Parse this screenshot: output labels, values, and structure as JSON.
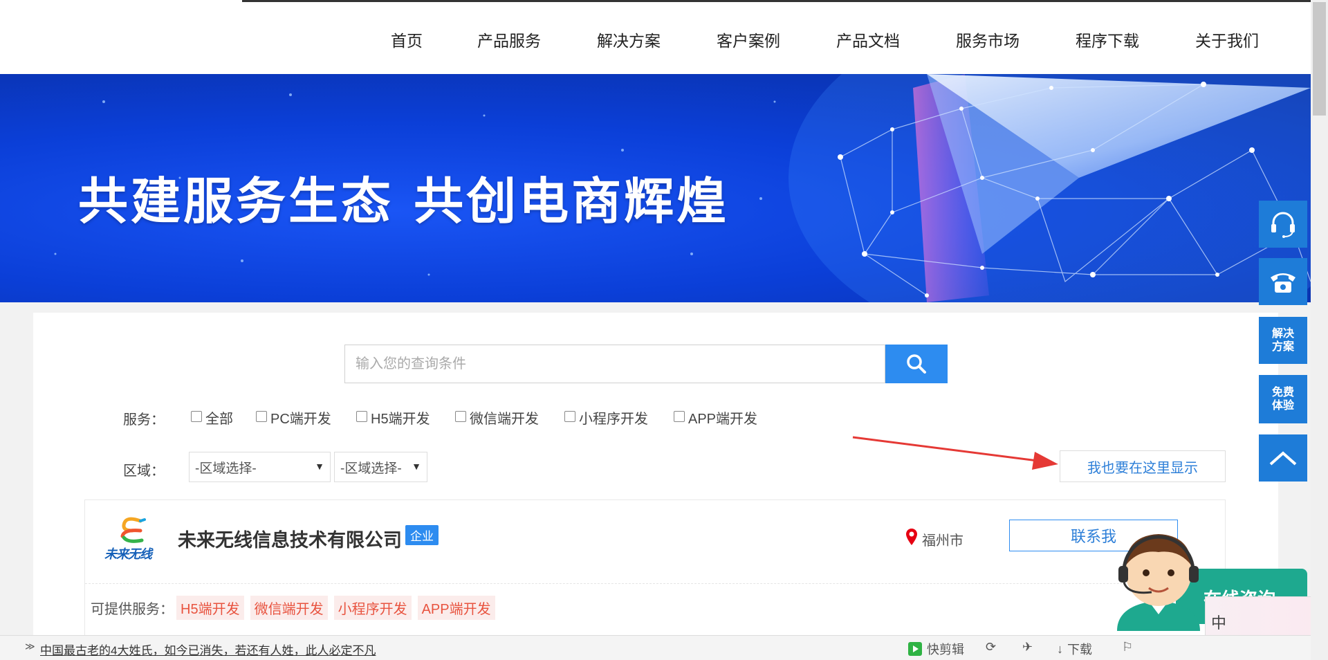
{
  "nav": {
    "items": [
      "首页",
      "产品服务",
      "解决方案",
      "客户案例",
      "产品文档",
      "服务市场",
      "程序下载",
      "关于我们"
    ]
  },
  "banner": {
    "slogan": "共建服务生态 共创电商辉煌"
  },
  "search": {
    "placeholder": "输入您的查询条件",
    "value": ""
  },
  "filters": {
    "service_label": "服务：",
    "service_options": [
      "全部",
      "PC端开发",
      "H5端开发",
      "微信端开发",
      "小程序开发",
      "APP端开发"
    ],
    "region_label": "区域：",
    "region_select_1": "-区域选择-",
    "region_select_2": "-区域选择-",
    "show_here_button": "我也要在这里显示"
  },
  "company": {
    "logo_text": "未来无线",
    "name": "未来无线信息技术有限公司",
    "badge": "企业",
    "city": "福州市",
    "contact_button": "联系我",
    "services_label": "可提供服务：",
    "services": [
      "H5端开发",
      "微信端开发",
      "小程序开发",
      "APP端开发"
    ]
  },
  "floatbar": {
    "solutions": "解决方案",
    "free_trial": "免费体验"
  },
  "chat": {
    "label": "在线咨询"
  },
  "ime": {
    "mode": "中"
  },
  "bottombar": {
    "news": "中国最古老的4大姓氏，如今已消失，若还有人姓，此人必定不凡",
    "quick_edit": "快剪辑",
    "download": "下载"
  },
  "colors": {
    "accent": "#2d8cf0",
    "floatbar": "#1e7cd8",
    "tag_text": "#e8533f",
    "chat": "#1ea98f"
  }
}
